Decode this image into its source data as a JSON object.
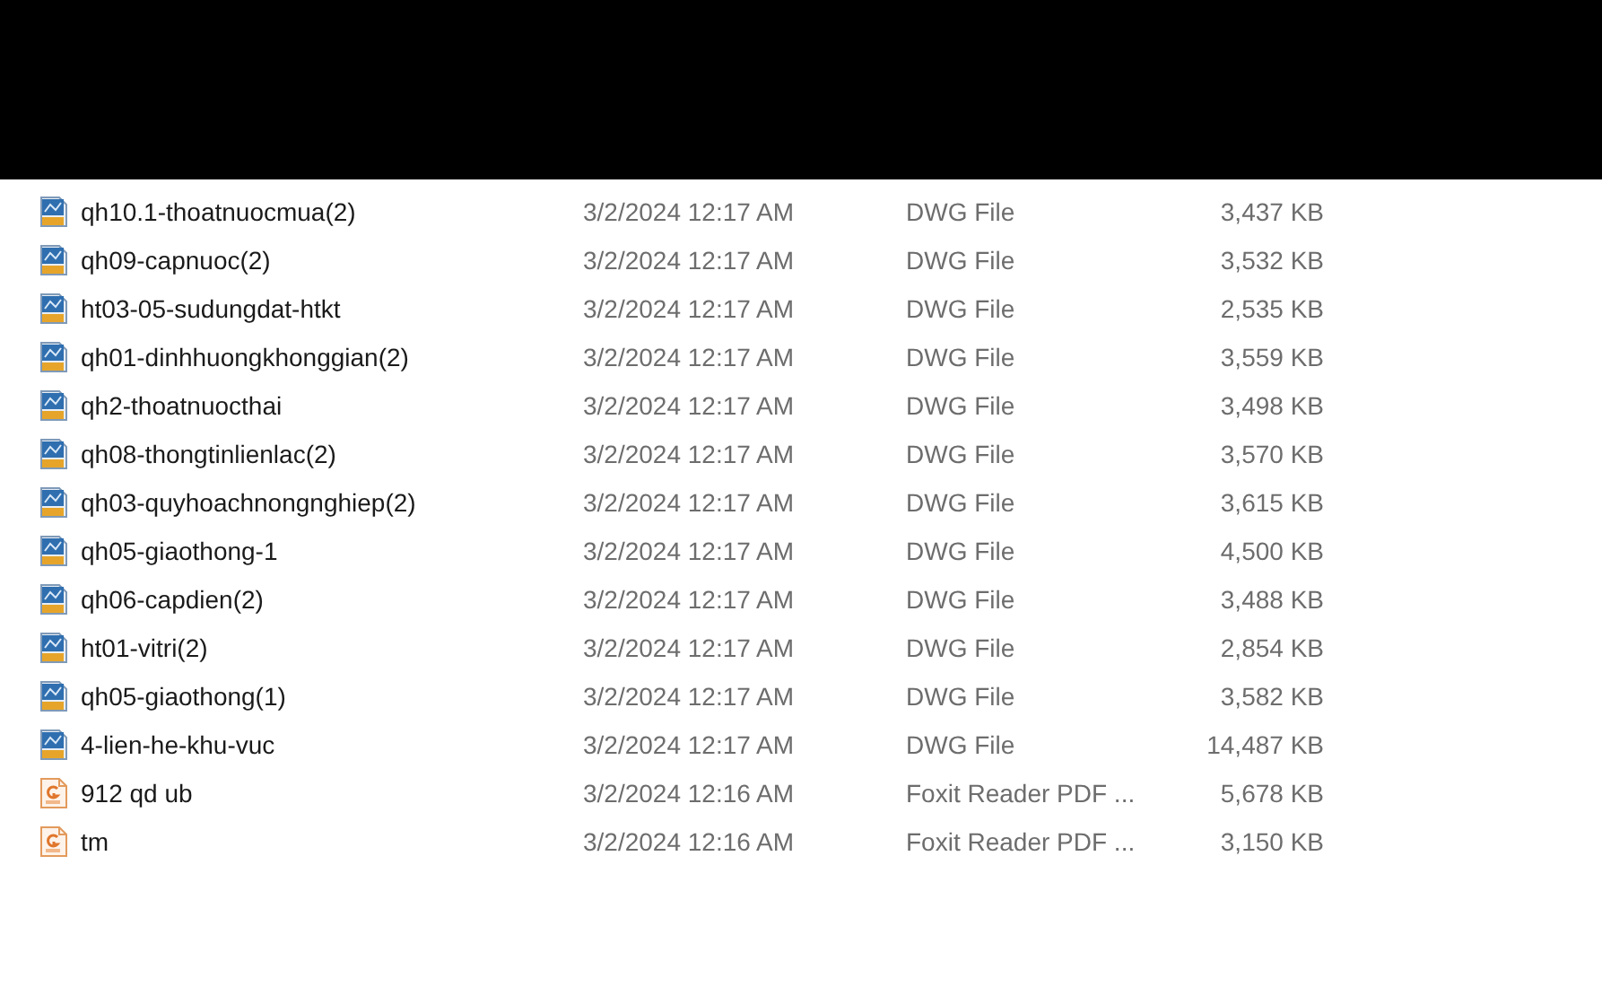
{
  "files": [
    {
      "kind": "dwg",
      "name": "qh10.1-thoatnuocmua(2)",
      "date": "3/2/2024 12:17 AM",
      "type": "DWG File",
      "size": "3,437 KB"
    },
    {
      "kind": "dwg",
      "name": "qh09-capnuoc(2)",
      "date": "3/2/2024 12:17 AM",
      "type": "DWG File",
      "size": "3,532 KB"
    },
    {
      "kind": "dwg",
      "name": "ht03-05-sudungdat-htkt",
      "date": "3/2/2024 12:17 AM",
      "type": "DWG File",
      "size": "2,535 KB"
    },
    {
      "kind": "dwg",
      "name": "qh01-dinhhuongkhonggian(2)",
      "date": "3/2/2024 12:17 AM",
      "type": "DWG File",
      "size": "3,559 KB"
    },
    {
      "kind": "dwg",
      "name": "qh2-thoatnuocthai",
      "date": "3/2/2024 12:17 AM",
      "type": "DWG File",
      "size": "3,498 KB"
    },
    {
      "kind": "dwg",
      "name": "qh08-thongtinlienlac(2)",
      "date": "3/2/2024 12:17 AM",
      "type": "DWG File",
      "size": "3,570 KB"
    },
    {
      "kind": "dwg",
      "name": "qh03-quyhoachnongnghiep(2)",
      "date": "3/2/2024 12:17 AM",
      "type": "DWG File",
      "size": "3,615 KB"
    },
    {
      "kind": "dwg",
      "name": "qh05-giaothong-1",
      "date": "3/2/2024 12:17 AM",
      "type": "DWG File",
      "size": "4,500 KB"
    },
    {
      "kind": "dwg",
      "name": "qh06-capdien(2)",
      "date": "3/2/2024 12:17 AM",
      "type": "DWG File",
      "size": "3,488 KB"
    },
    {
      "kind": "dwg",
      "name": "ht01-vitri(2)",
      "date": "3/2/2024 12:17 AM",
      "type": "DWG File",
      "size": "2,854 KB"
    },
    {
      "kind": "dwg",
      "name": "qh05-giaothong(1)",
      "date": "3/2/2024 12:17 AM",
      "type": "DWG File",
      "size": "3,582 KB"
    },
    {
      "kind": "dwg",
      "name": "4-lien-he-khu-vuc",
      "date": "3/2/2024 12:17 AM",
      "type": "DWG File",
      "size": "14,487 KB"
    },
    {
      "kind": "pdf",
      "name": "912 qd ub",
      "date": "3/2/2024 12:16 AM",
      "type": "Foxit Reader PDF ...",
      "size": "5,678 KB"
    },
    {
      "kind": "pdf",
      "name": "tm",
      "date": "3/2/2024 12:16 AM",
      "type": "Foxit Reader PDF ...",
      "size": "3,150 KB"
    }
  ]
}
